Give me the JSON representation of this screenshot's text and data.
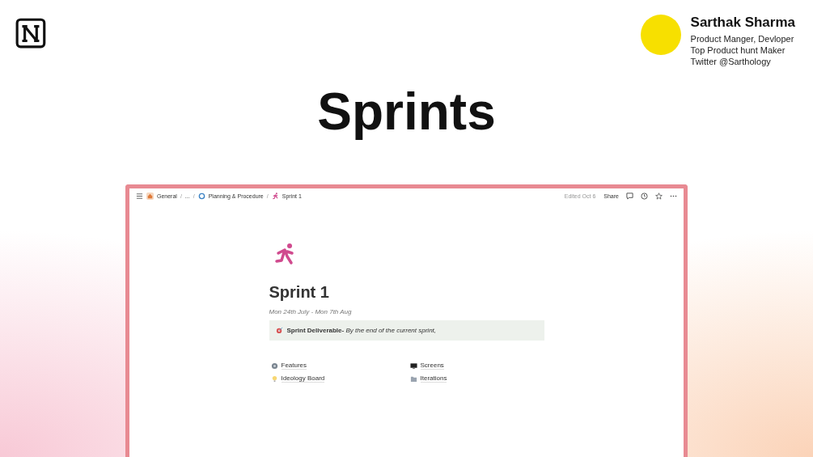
{
  "author": {
    "name": "Sarthak Sharma",
    "lines": [
      "Product Manger, Devloper",
      "Top Product hunt Maker",
      "Twitter @Sarthology"
    ]
  },
  "title": "Sprints",
  "window": {
    "breadcrumbs": [
      {
        "label": "General",
        "kind": "home",
        "separator": "/"
      },
      {
        "label": "...",
        "kind": "plain",
        "separator": "/"
      },
      {
        "label": "Planning & Procedure",
        "kind": "circle",
        "separator": "/"
      },
      {
        "label": "Sprint 1",
        "kind": "runner"
      }
    ],
    "edited": "Edited Oct 6",
    "share": "Share",
    "page": {
      "title": "Sprint 1",
      "dates": "Mon 24th July - Mon 7th Aug",
      "callout": "**Sprint Deliverable-** *By the end of the current sprint,*",
      "links": [
        {
          "label": "Features",
          "kind": "gear"
        },
        {
          "label": "Screens",
          "kind": "monitor"
        },
        {
          "label": "Ideology Board",
          "kind": "bulb"
        },
        {
          "label": "Iterations",
          "kind": "folder"
        }
      ]
    }
  }
}
